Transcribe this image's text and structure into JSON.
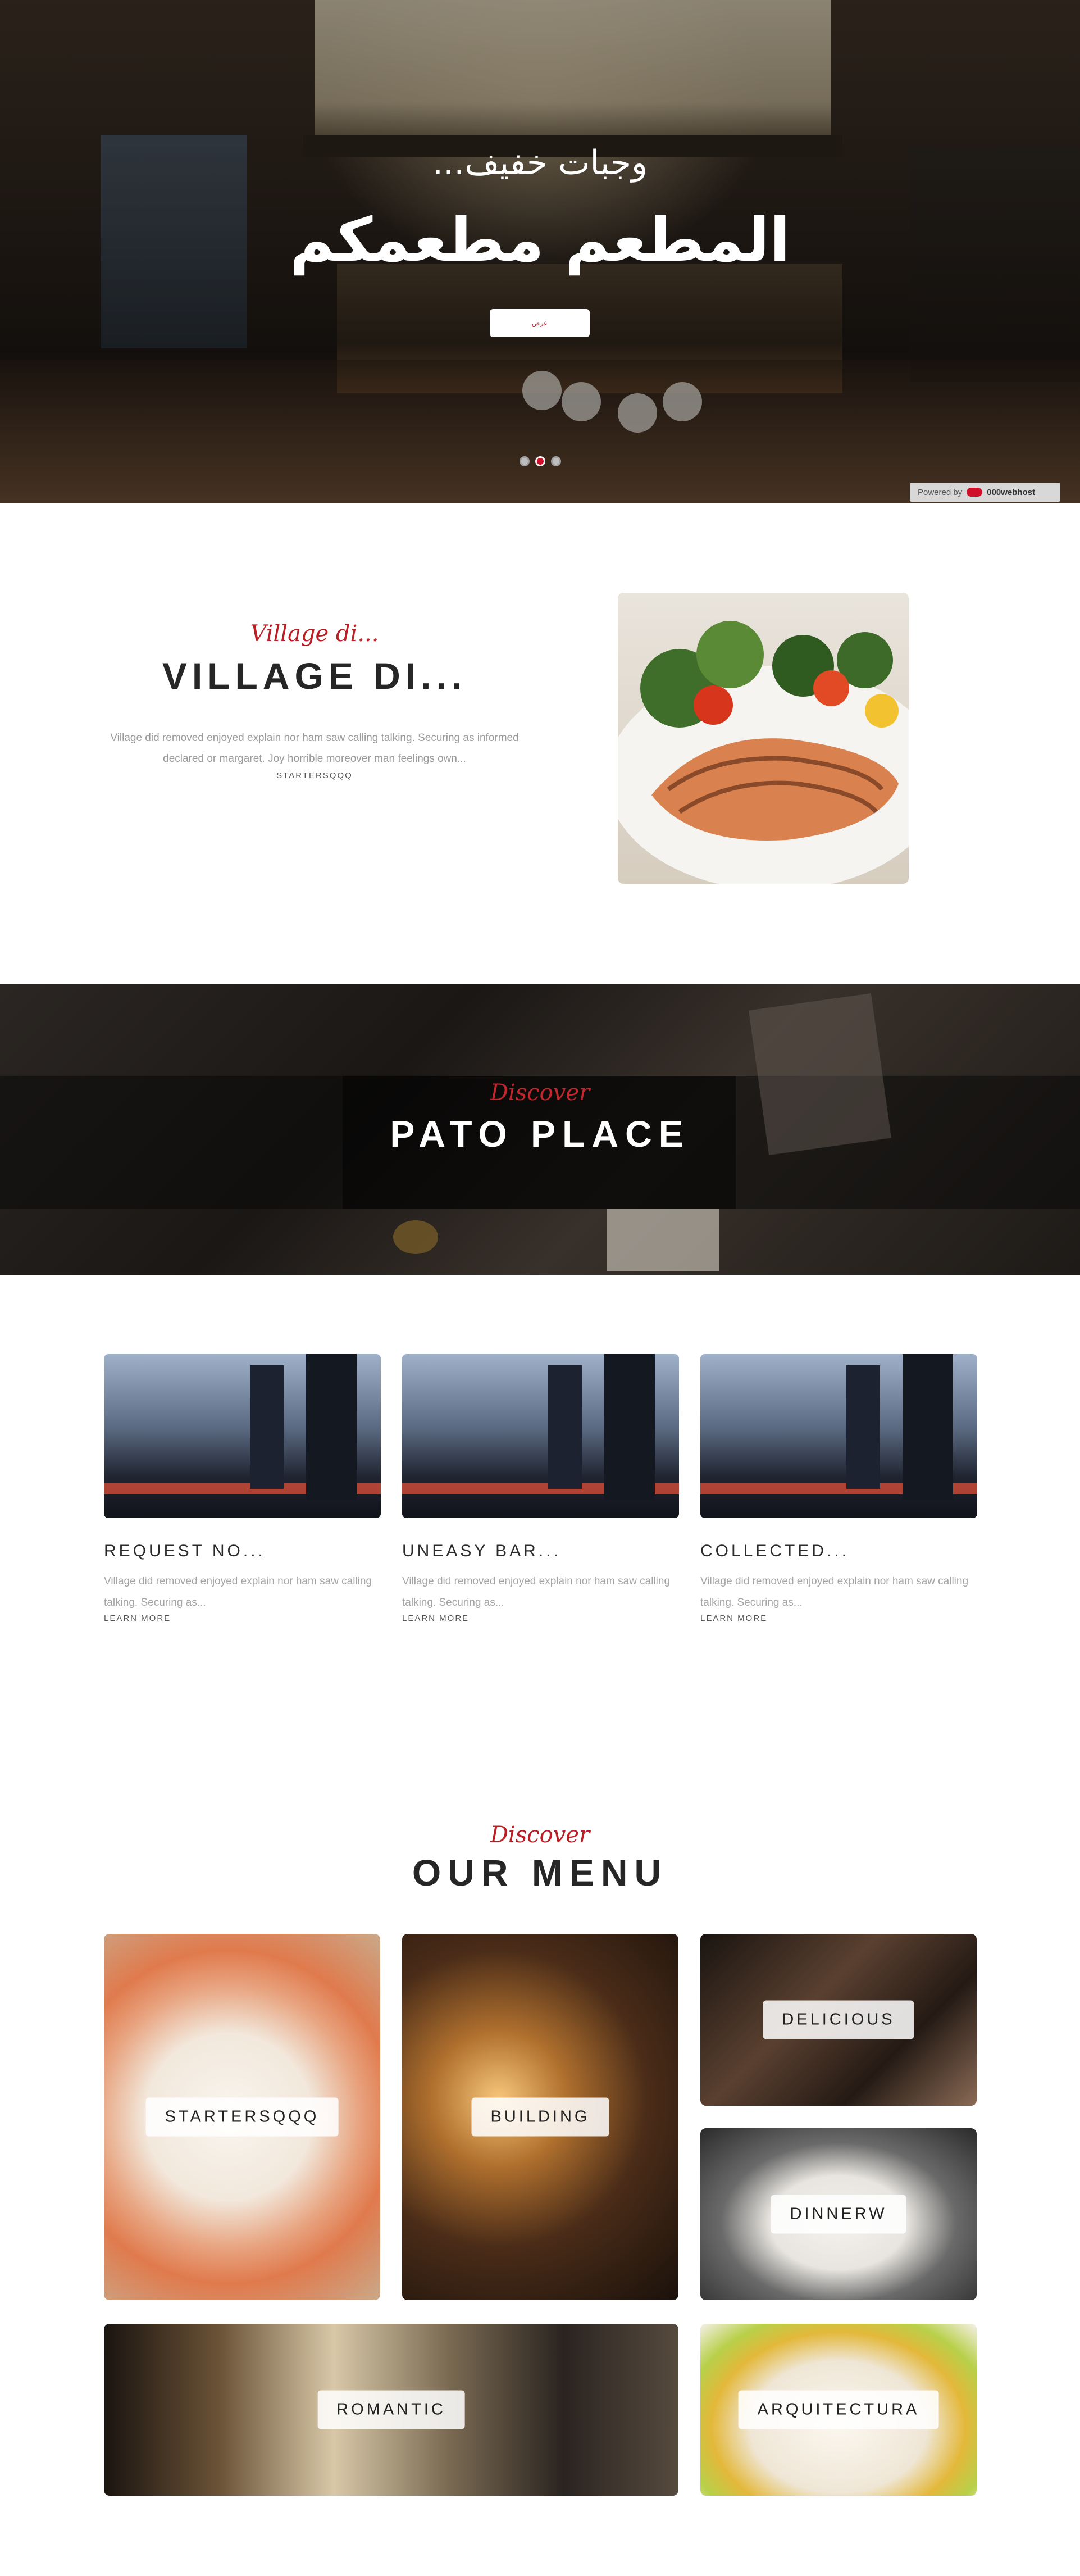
{
  "hero": {
    "subtitle": "وجبات خفيف...",
    "title": "المطعم مطعمكم",
    "button_label": "عرض",
    "slides": [
      {
        "active": false
      },
      {
        "active": true
      },
      {
        "active": false
      }
    ]
  },
  "powered_by": {
    "prefix": "Powered by",
    "brand": "000webhost"
  },
  "about": {
    "script_title": "Village di...",
    "title": "VILLAGE DI...",
    "text": "Village did removed enjoyed explain nor ham saw calling talking. Securing as informed declared or margaret. Joy horrible moreover man feelings own...",
    "link": "STARTERSQQQ"
  },
  "band": {
    "script_title": "Discover",
    "title": "PATO PLACE"
  },
  "cards": [
    {
      "title": "REQUEST NO...",
      "text": "Village did removed enjoyed explain nor ham saw calling talking. Securing as...",
      "link": "LEARN MORE"
    },
    {
      "title": "UNEASY BAR...",
      "text": "Village did removed enjoyed explain nor ham saw calling talking. Securing as...",
      "link": "LEARN MORE"
    },
    {
      "title": "COLLECTED...",
      "text": "Village did removed enjoyed explain nor ham saw calling talking. Securing as...",
      "link": "LEARN MORE"
    }
  ],
  "menu": {
    "script_title": "Discover",
    "title": "OUR MENU",
    "tiles": {
      "starters": "STARTERSQQQ",
      "building": "BUILDING",
      "delicious": "DELICIOUS",
      "dinner": "DINNERW",
      "romantic": "ROMANTIC",
      "arquitectura": "ARQUITECTURA"
    }
  },
  "colors": {
    "accent": "#c0282d",
    "heading": "#262626",
    "body_text": "#9a9a9a"
  }
}
